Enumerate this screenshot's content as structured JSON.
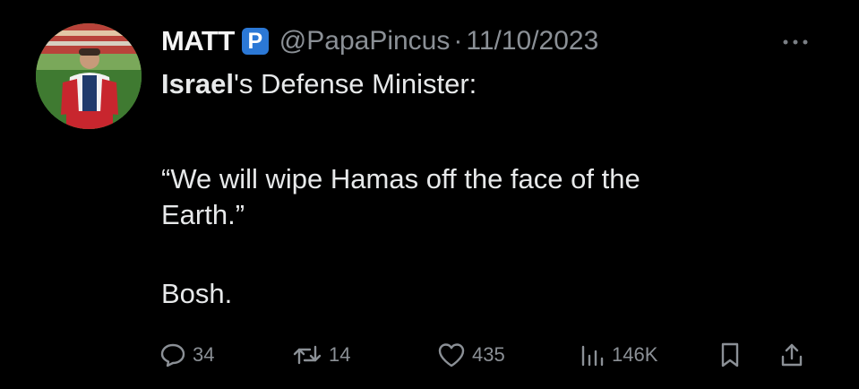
{
  "tweet": {
    "author": {
      "display_name": "MATT",
      "badge": "P",
      "handle": "@PapaPincus",
      "avatar_icon": "user-avatar-photo"
    },
    "separator": "·",
    "date": "11/10/2023",
    "more_icon": "more-options-icon",
    "text": {
      "line1_bold": "Israel",
      "line1_rest": "'s Defense Minister:",
      "quote_line1": "“We will wipe Hamas off the face of the",
      "quote_line2": "Earth.”",
      "closing": "Bosh."
    },
    "actions": {
      "replies": "34",
      "retweets": "14",
      "likes": "435",
      "views": "146K"
    }
  },
  "colors": {
    "background": "#000000",
    "text": "#e7e9ea",
    "muted": "#8b9096",
    "badge": "#2b78d6"
  }
}
